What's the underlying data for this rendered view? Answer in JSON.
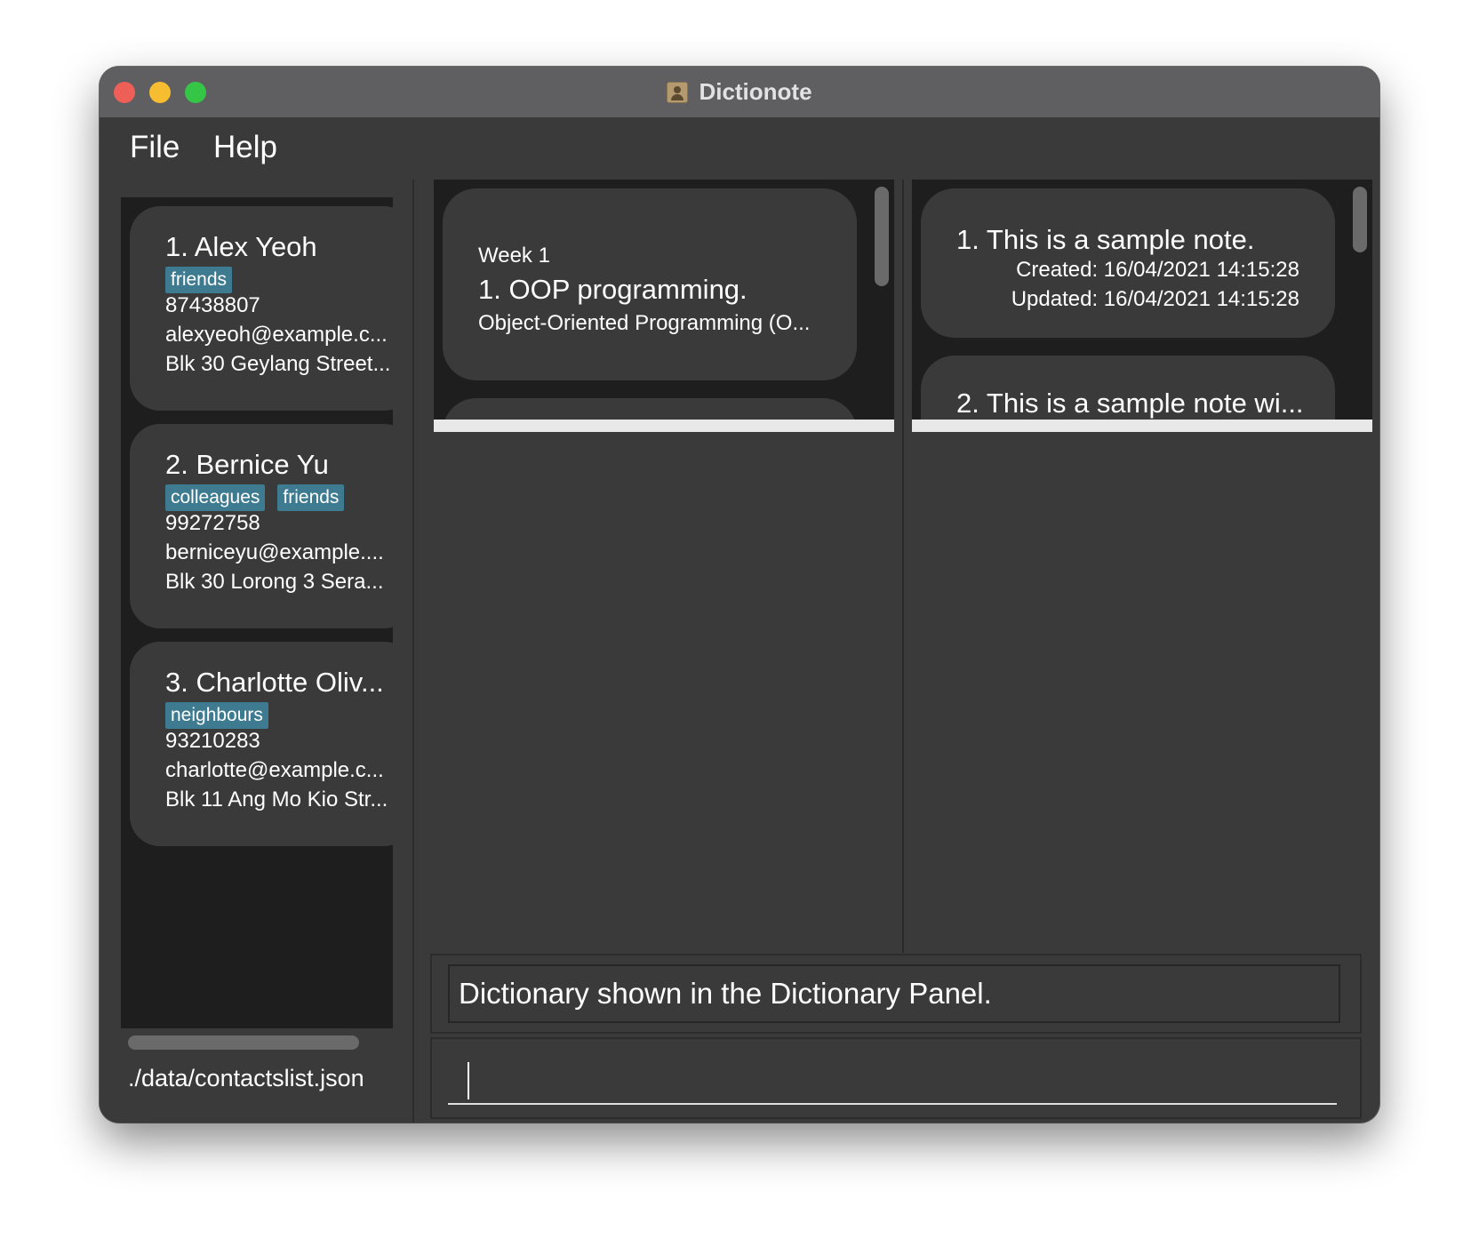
{
  "window": {
    "title": "Dictionote"
  },
  "menu": {
    "file": "File",
    "help": "Help"
  },
  "contacts": [
    {
      "name": "1.  Alex Yeoh",
      "tags": [
        "friends"
      ],
      "phone": "87438807",
      "email": "alexyeoh@example.c...",
      "address": "Blk 30 Geylang Street..."
    },
    {
      "name": "2.  Bernice Yu",
      "tags": [
        "colleagues",
        "friends"
      ],
      "phone": "99272758",
      "email": "berniceyu@example....",
      "address": "Blk 30 Lorong 3 Sera..."
    },
    {
      "name": "3.  Charlotte Oliv...",
      "tags": [
        "neighbours"
      ],
      "phone": "93210283",
      "email": "charlotte@example.c...",
      "address": "Blk 11 Ang Mo Kio Str..."
    }
  ],
  "file_path": "./data/contactslist.json",
  "dictionary": {
    "entries": [
      {
        "week": "Week 1",
        "title": "1.  OOP programming.",
        "description": "Object-Oriented Programming (O..."
      }
    ]
  },
  "notes": {
    "entries": [
      {
        "title": "1.  This is a sample note.",
        "created": "Created: 16/04/2021 14:15:28",
        "updated": "Updated: 16/04/2021 14:15:28"
      },
      {
        "title": "2.  This is a sample note wi..."
      }
    ]
  },
  "result_display": "Dictionary shown in the Dictionary Panel.",
  "command_box": {
    "value": "",
    "placeholder": ""
  }
}
